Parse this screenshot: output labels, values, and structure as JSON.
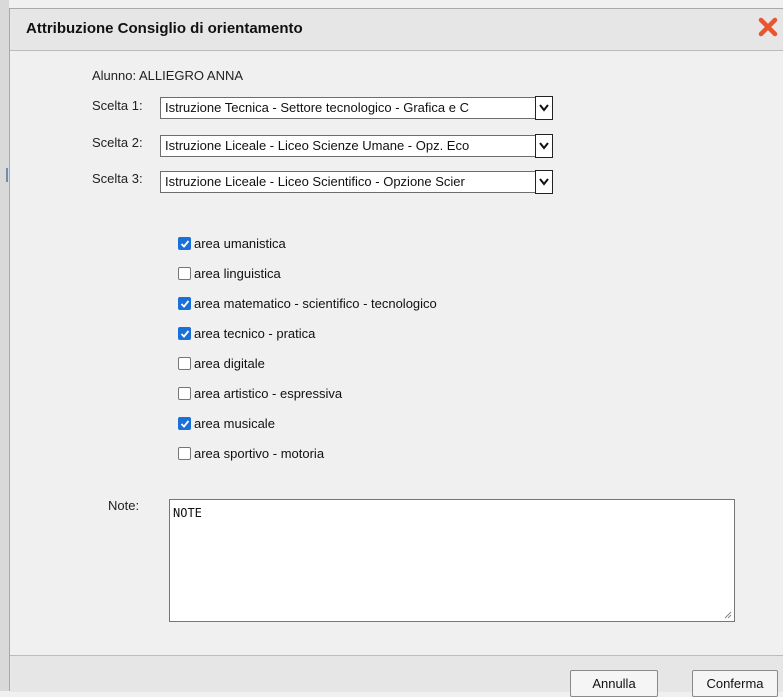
{
  "dialog": {
    "title": "Attribuzione Consiglio di orientamento",
    "close_icon": "close-icon"
  },
  "student": {
    "label": "Alunno:",
    "name": "ALLIEGRO ANNA"
  },
  "choices": [
    {
      "label": "Scelta 1:",
      "value": "Istruzione Tecnica - Settore tecnologico - Grafica e C"
    },
    {
      "label": "Scelta 2:",
      "value": "Istruzione Liceale - Liceo Scienze Umane - Opz. Eco"
    },
    {
      "label": "Scelta 3:",
      "value": "Istruzione Liceale - Liceo Scientifico - Opzione Scier"
    }
  ],
  "areas": [
    {
      "label": "area umanistica",
      "checked": true
    },
    {
      "label": "area linguistica",
      "checked": false
    },
    {
      "label": "area matematico - scientifico - tecnologico",
      "checked": true
    },
    {
      "label": "area tecnico - pratica",
      "checked": true
    },
    {
      "label": "area digitale",
      "checked": false
    },
    {
      "label": "area artistico - espressiva",
      "checked": false
    },
    {
      "label": "area musicale",
      "checked": true
    },
    {
      "label": "area sportivo - motoria",
      "checked": false
    }
  ],
  "note": {
    "label": "Note:",
    "value": "NOTE"
  },
  "buttons": {
    "cancel": "Annulla",
    "confirm": "Conferma"
  },
  "colors": {
    "close": "#e8552f",
    "checkbox_checked": "#1a6fd8"
  }
}
